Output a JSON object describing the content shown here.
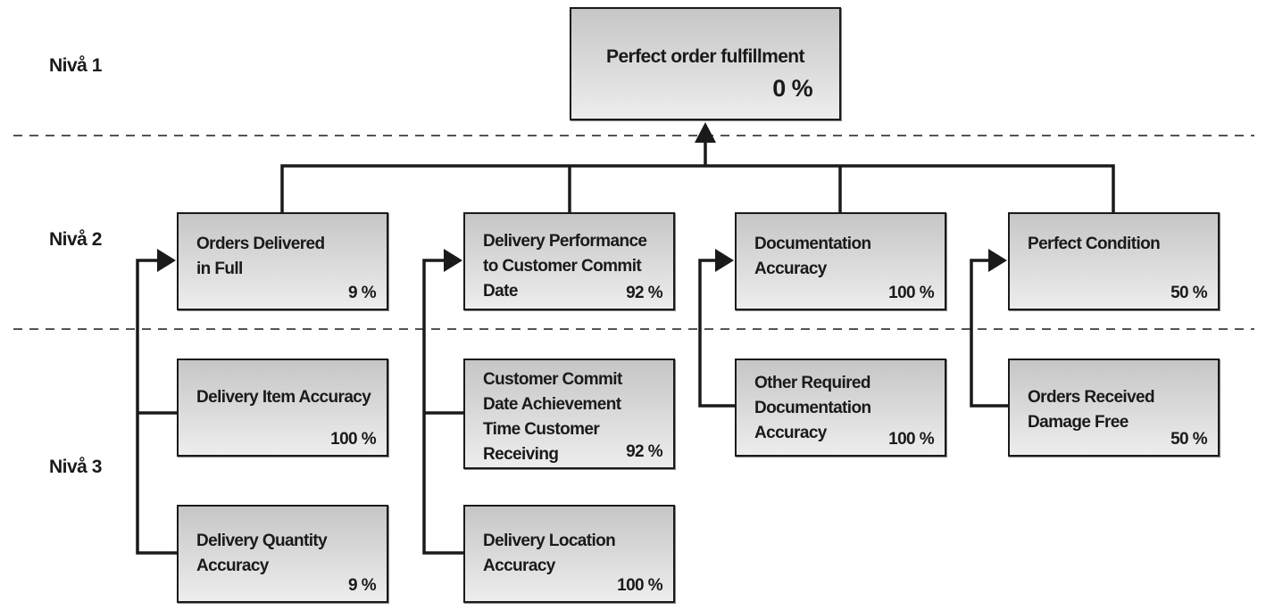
{
  "levels": [
    "Nivå 1",
    "Nivå 2",
    "Nivå 3"
  ],
  "root": {
    "title": "Perfect order fulfillment",
    "value": "0 %"
  },
  "level2": [
    {
      "title": "Orders Delivered\nin Full",
      "value": "9 %"
    },
    {
      "title": "Delivery Performance\nto Customer Commit\nDate",
      "value": "92 %"
    },
    {
      "title": "Documentation\nAccuracy",
      "value": "100 %"
    },
    {
      "title": "Perfect Condition",
      "value": "50 %"
    }
  ],
  "level3": [
    {
      "title": "Delivery Item Accuracy",
      "value": "100 %"
    },
    {
      "title": "Delivery Quantity\nAccuracy",
      "value": "9 %"
    },
    {
      "title": "Customer Commit\nDate Achievement\nTime Customer\nReceiving",
      "value": "92 %"
    },
    {
      "title": "Delivery Location\nAccuracy",
      "value": "100 %"
    },
    {
      "title": "Other Required\nDocumentation\nAccuracy",
      "value": "100 %"
    },
    {
      "title": "Orders Received\nDamage Free",
      "value": "50 %"
    }
  ],
  "colors": {
    "line": "#1a1a1a",
    "box_top": "#c6c6c6",
    "box_bottom": "#ededed"
  }
}
